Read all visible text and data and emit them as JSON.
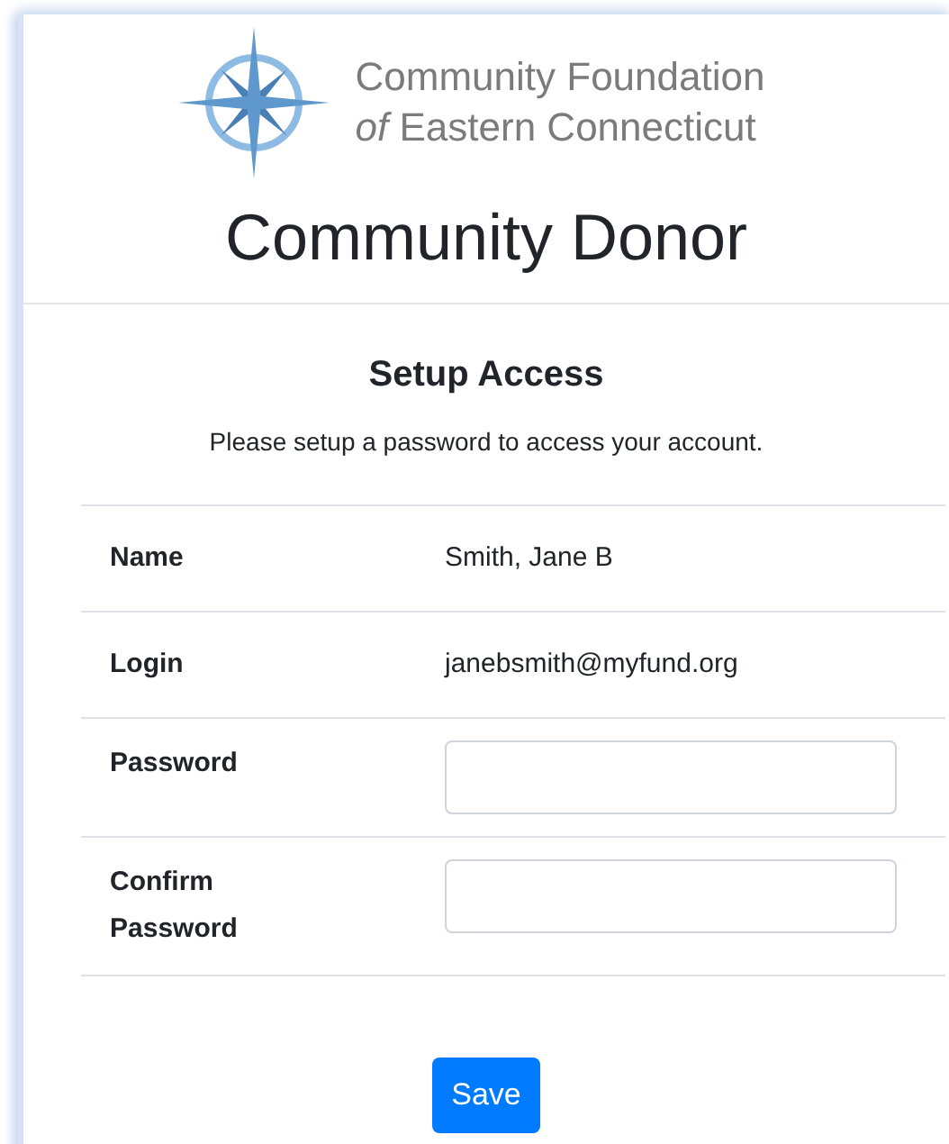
{
  "logo": {
    "line_1": "Community Foundation",
    "line_2_prefix": "of",
    "line_2": "Eastern Connecticut"
  },
  "title": "Community Donor",
  "form": {
    "heading": "Setup Access",
    "instructions": "Please setup a password to access your account.",
    "rows": [
      {
        "label": "Name",
        "kind": "text",
        "value": "Smith, Jane B"
      },
      {
        "label": "Login",
        "kind": "text",
        "value": "janebsmith@myfund.org"
      },
      {
        "label": "Password",
        "kind": "input"
      },
      {
        "label": "Confirm Password",
        "kind": "input"
      }
    ],
    "button": "Save"
  }
}
